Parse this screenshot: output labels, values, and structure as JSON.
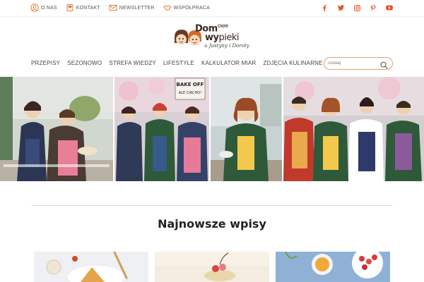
{
  "topbar": {
    "links": [
      {
        "label": "O NAS",
        "icon": "user-circle-icon"
      },
      {
        "label": "KONTAKT",
        "icon": "phone-icon"
      },
      {
        "label": "NEWSLETTER",
        "icon": "envelope-icon"
      },
      {
        "label": "WSPÓŁPRACA",
        "icon": "handshake-icon"
      }
    ],
    "social": [
      "facebook-icon",
      "twitter-icon",
      "instagram-icon",
      "pinterest-icon",
      "youtube-icon"
    ]
  },
  "logo": {
    "line1": "Dom",
    "line1_small": "owe",
    "line2": "wy",
    "line2_rest": "pieki",
    "line3": "u Justyny i Doroty"
  },
  "nav": {
    "items": [
      "PRZEPISY",
      "SEZONOWO",
      "STREFA WIEDZY",
      "LIFESTYLE",
      "KALKULATOR MIAR",
      "ZDJĘCIA KULINARNE"
    ]
  },
  "search": {
    "placeholder": "Szukaj"
  },
  "hero": {
    "sign": "BAKE OFF ALE CIACHO!"
  },
  "main": {
    "heading": "Najnowsze wpisy"
  },
  "colors": {
    "accent": "#e07b39",
    "social": "#e2572b"
  }
}
